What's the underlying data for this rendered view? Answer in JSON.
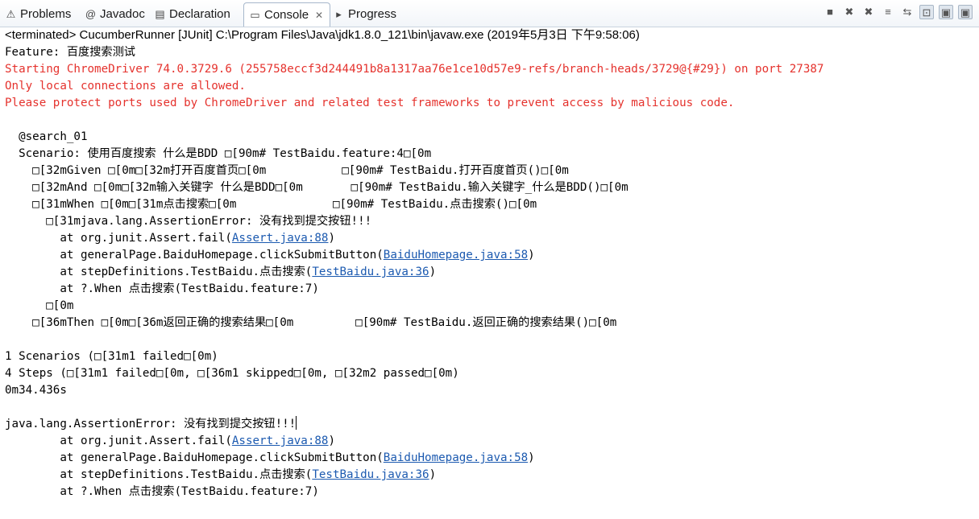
{
  "tabs": [
    {
      "label": "Problems",
      "icon": "problems-icon",
      "glyph": "⚠"
    },
    {
      "label": "Javadoc",
      "icon": "javadoc-icon",
      "glyph": "@"
    },
    {
      "label": "Declaration",
      "icon": "declaration-icon",
      "glyph": "▤"
    },
    {
      "label": "Console",
      "icon": "console-icon",
      "glyph": "▭",
      "close": "✕"
    },
    {
      "label": "Progress",
      "icon": "progress-icon",
      "glyph": "▸"
    }
  ],
  "toolbar": [
    {
      "name": "terminate-icon",
      "glyph": "■"
    },
    {
      "name": "remove-launch-icon",
      "glyph": "✖"
    },
    {
      "name": "remove-all-terminated-icon",
      "glyph": "✖"
    },
    {
      "name": "scroll-lock-icon",
      "glyph": "≡"
    },
    {
      "name": "word-wrap-icon",
      "glyph": "⇆"
    },
    {
      "name": "pin-console-icon",
      "glyph": "⊡"
    },
    {
      "name": "display-selected-console-icon",
      "glyph": "▣"
    },
    {
      "name": "open-console-icon",
      "glyph": "▣"
    }
  ],
  "status": "<terminated> CucumberRunner [JUnit] C:\\Program Files\\Java\\jdk1.8.0_121\\bin\\javaw.exe (2019年5月3日 下午9:58:06)",
  "lines": [
    {
      "segments": [
        {
          "t": "Feature: 百度搜索测试"
        }
      ]
    },
    {
      "segments": [
        {
          "t": "Starting ChromeDriver 74.0.3729.6 (255758eccf3d244491b8a1317aa76e1ce10d57e9-refs/branch-heads/3729@{#29}) on port 27387",
          "c": "red"
        }
      ]
    },
    {
      "segments": [
        {
          "t": "Only local connections are allowed.",
          "c": "red"
        }
      ]
    },
    {
      "segments": [
        {
          "t": "Please protect ports used by ChromeDriver and related test frameworks to prevent access by malicious code.",
          "c": "red"
        }
      ]
    },
    {
      "segments": [
        {
          "t": ""
        }
      ]
    },
    {
      "segments": [
        {
          "t": "  @search_01"
        }
      ]
    },
    {
      "segments": [
        {
          "t": "  Scenario: 使用百度搜索 什么是BDD \u001b[90m# TestBaidu.feature:4\u001b[0m"
        }
      ]
    },
    {
      "segments": [
        {
          "t": "    \u001b[32mGiven \u001b[0m\u001b[32m打开百度首页\u001b[0m           \u001b[90m# TestBaidu.打开百度首页()\u001b[0m"
        }
      ]
    },
    {
      "segments": [
        {
          "t": "    \u001b[32mAnd \u001b[0m\u001b[32m输入关键字 什么是BDD\u001b[0m       \u001b[90m# TestBaidu.输入关键字_什么是BDD()\u001b[0m"
        }
      ]
    },
    {
      "segments": [
        {
          "t": "    \u001b[31mWhen \u001b[0m\u001b[31m点击搜索\u001b[0m              \u001b[90m# TestBaidu.点击搜索()\u001b[0m"
        }
      ]
    },
    {
      "segments": [
        {
          "t": "      \u001b[31mjava.lang.AssertionError: 没有找到提交按钮!!!"
        }
      ]
    },
    {
      "segments": [
        {
          "t": "        at org.junit.Assert.fail("
        },
        {
          "t": "Assert.java:88",
          "c": "lnk"
        },
        {
          "t": ")"
        }
      ]
    },
    {
      "segments": [
        {
          "t": "        at generalPage.BaiduHomepage.clickSubmitButton("
        },
        {
          "t": "BaiduHomepage.java:58",
          "c": "lnk"
        },
        {
          "t": ")"
        }
      ]
    },
    {
      "segments": [
        {
          "t": "        at stepDefinitions.TestBaidu.点击搜索("
        },
        {
          "t": "TestBaidu.java:36",
          "c": "lnk"
        },
        {
          "t": ")"
        }
      ]
    },
    {
      "segments": [
        {
          "t": "        at ?.When 点击搜索(TestBaidu.feature:7)"
        }
      ]
    },
    {
      "segments": [
        {
          "t": "      \u001b[0m"
        }
      ]
    },
    {
      "segments": [
        {
          "t": "    \u001b[36mThen \u001b[0m\u001b[36m返回正确的搜索结果\u001b[0m         \u001b[90m# TestBaidu.返回正确的搜索结果()\u001b[0m"
        }
      ]
    },
    {
      "segments": [
        {
          "t": ""
        }
      ]
    },
    {
      "segments": [
        {
          "t": "1 Scenarios (\u001b[31m1 failed\u001b[0m)"
        }
      ]
    },
    {
      "segments": [
        {
          "t": "4 Steps (\u001b[31m1 failed\u001b[0m, \u001b[36m1 skipped\u001b[0m, \u001b[32m2 passed\u001b[0m)"
        }
      ]
    },
    {
      "segments": [
        {
          "t": "0m34.436s"
        }
      ]
    },
    {
      "segments": [
        {
          "t": ""
        }
      ]
    },
    {
      "segments": [
        {
          "t": "java.lang.AssertionError: 没有找到提交按钮!!!"
        }
      ],
      "caret": true
    },
    {
      "segments": [
        {
          "t": "        at org.junit.Assert.fail("
        },
        {
          "t": "Assert.java:88",
          "c": "lnk"
        },
        {
          "t": ")"
        }
      ]
    },
    {
      "segments": [
        {
          "t": "        at generalPage.BaiduHomepage.clickSubmitButton("
        },
        {
          "t": "BaiduHomepage.java:58",
          "c": "lnk"
        },
        {
          "t": ")"
        }
      ]
    },
    {
      "segments": [
        {
          "t": "        at stepDefinitions.TestBaidu.点击搜索("
        },
        {
          "t": "TestBaidu.java:36",
          "c": "lnk"
        },
        {
          "t": ")"
        }
      ]
    },
    {
      "segments": [
        {
          "t": "        at ?.When 点击搜索(TestBaidu.feature:7)"
        }
      ]
    }
  ]
}
